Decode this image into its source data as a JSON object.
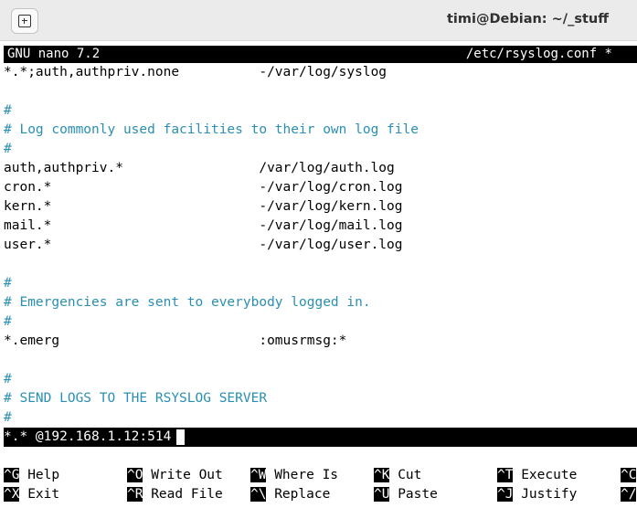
{
  "window": {
    "title": "timi@Debian: ~/_stuff",
    "new_tab_icon": "new-tab-icon"
  },
  "nano": {
    "version": "GNU nano 7.2",
    "file": "/etc/rsyslog.conf *"
  },
  "lines": [
    {
      "text": "*.*;auth,authpriv.none          -/var/log/syslog",
      "comment": false
    },
    {
      "text": "",
      "comment": false
    },
    {
      "text": "#",
      "comment": true
    },
    {
      "text": "# Log commonly used facilities to their own log file",
      "comment": true
    },
    {
      "text": "#",
      "comment": true
    },
    {
      "text": "auth,authpriv.*                 /var/log/auth.log",
      "comment": false
    },
    {
      "text": "cron.*                          -/var/log/cron.log",
      "comment": false
    },
    {
      "text": "kern.*                          -/var/log/kern.log",
      "comment": false
    },
    {
      "text": "mail.*                          -/var/log/mail.log",
      "comment": false
    },
    {
      "text": "user.*                          -/var/log/user.log",
      "comment": false
    },
    {
      "text": "",
      "comment": false
    },
    {
      "text": "#",
      "comment": true
    },
    {
      "text": "# Emergencies are sent to everybody logged in.",
      "comment": true
    },
    {
      "text": "#",
      "comment": true
    },
    {
      "text": "*.emerg                         :omusrmsg:*",
      "comment": false
    },
    {
      "text": "",
      "comment": false
    },
    {
      "text": "#",
      "comment": true
    },
    {
      "text": "# SEND LOGS TO THE RSYSLOG SERVER",
      "comment": true
    },
    {
      "text": "#",
      "comment": true
    }
  ],
  "selected_line": "*.* @192.168.1.12:514",
  "shortcuts": [
    {
      "key": "^G",
      "label": "Help"
    },
    {
      "key": "^O",
      "label": "Write Out"
    },
    {
      "key": "^W",
      "label": "Where Is"
    },
    {
      "key": "^K",
      "label": "Cut"
    },
    {
      "key": "^T",
      "label": "Execute"
    },
    {
      "key": "^C",
      "label": ""
    },
    {
      "key": "^X",
      "label": "Exit"
    },
    {
      "key": "^R",
      "label": "Read File"
    },
    {
      "key": "^\\",
      "label": "Replace"
    },
    {
      "key": "^U",
      "label": "Paste"
    },
    {
      "key": "^J",
      "label": "Justify"
    },
    {
      "key": "^/",
      "label": ""
    }
  ]
}
